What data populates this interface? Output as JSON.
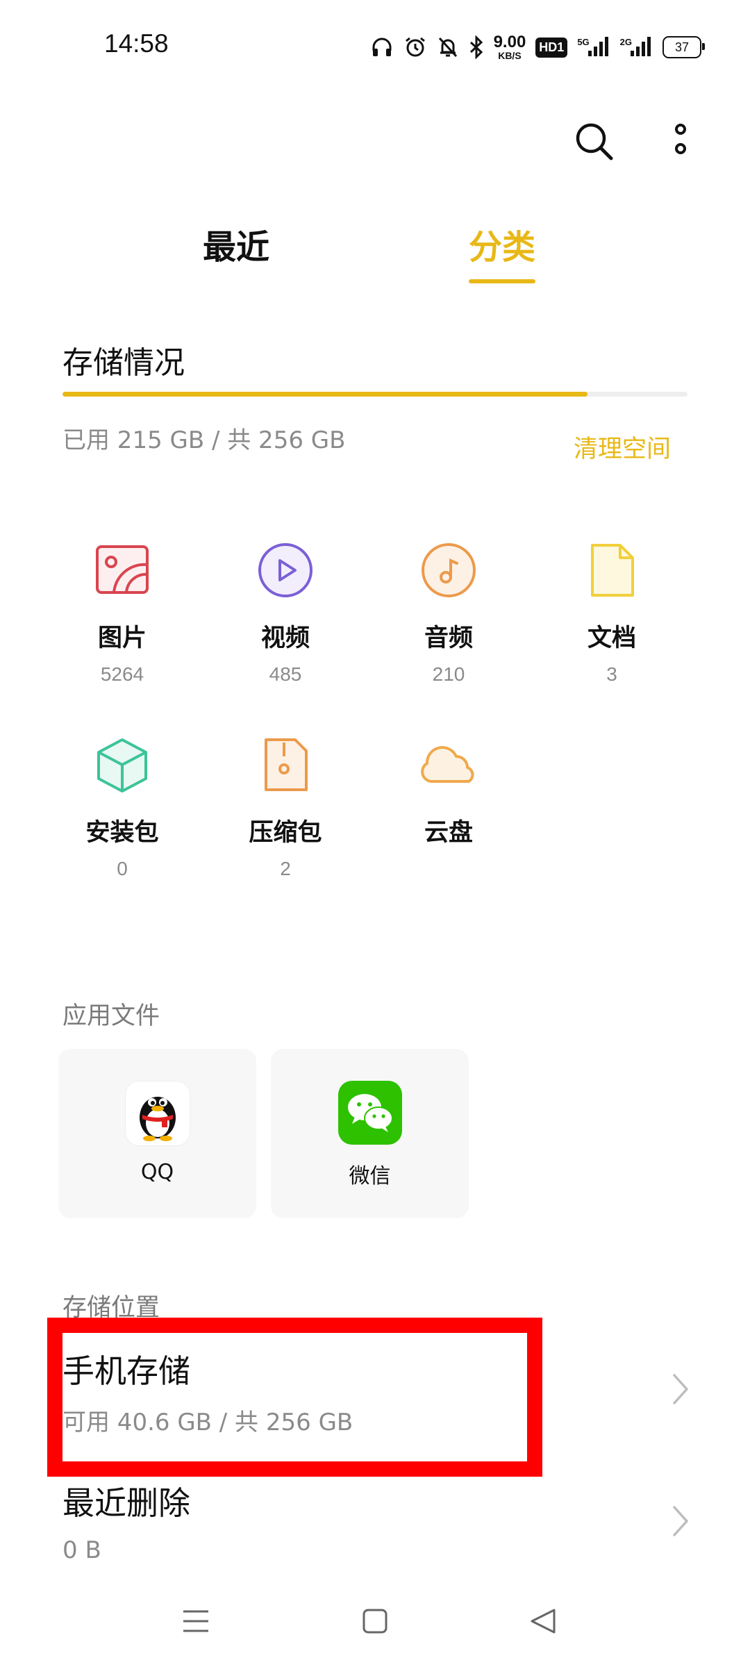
{
  "status_bar": {
    "time": "14:58",
    "net_speed_value": "9.00",
    "net_speed_unit": "KB/S",
    "hd_badge": "HD1",
    "sim1_label": "5G",
    "sim2_label": "2G",
    "battery_level": "37",
    "icons": [
      "headset-icon",
      "alarm-icon",
      "bell-off-icon",
      "bluetooth-icon",
      "signal-icon",
      "signal-icon"
    ]
  },
  "toolbar": {
    "icons": [
      "search-icon",
      "more-vertical-icon"
    ]
  },
  "tabs": [
    {
      "label": "最近",
      "active": false
    },
    {
      "label": "分类",
      "active": true
    }
  ],
  "storage": {
    "title": "存储情况",
    "used_text": "已用 215 GB / 共 256 GB",
    "used_fraction": 0.84,
    "clean_label": "清理空间",
    "accent_color": "#e8b817"
  },
  "categories": [
    {
      "label": "图片",
      "count": "5264",
      "icon": "image-icon",
      "color": "#d9454f"
    },
    {
      "label": "视频",
      "count": "485",
      "icon": "video-play-icon",
      "color": "#7b5fd6"
    },
    {
      "label": "音频",
      "count": "210",
      "icon": "music-note-icon",
      "color": "#ec9a4b"
    },
    {
      "label": "文档",
      "count": "3",
      "icon": "document-icon",
      "color": "#f2cf3c"
    },
    {
      "label": "安装包",
      "count": "0",
      "icon": "package-cube-icon",
      "color": "#3cc39a"
    },
    {
      "label": "压缩包",
      "count": "2",
      "icon": "zip-archive-icon",
      "color": "#ec9a4b"
    },
    {
      "label": "云盘",
      "icon": "cloud-icon",
      "color": "#f0a94c"
    }
  ],
  "app_files": {
    "title": "应用文件",
    "apps": [
      {
        "label": "QQ",
        "icon": "qq-penguin-icon"
      },
      {
        "label": "微信",
        "icon": "wechat-icon",
        "color": "#2dc100"
      }
    ]
  },
  "storage_locations": {
    "title": "存储位置",
    "items": [
      {
        "title": "手机存储",
        "subtitle": "可用 40.6 GB / 共 256 GB",
        "highlighted": true
      },
      {
        "title": "最近删除",
        "subtitle": "0 B"
      }
    ],
    "highlight_color": "#ff0000"
  },
  "nav_bar": {
    "icons": [
      "menu-icon",
      "home-square-icon",
      "back-triangle-icon"
    ]
  }
}
